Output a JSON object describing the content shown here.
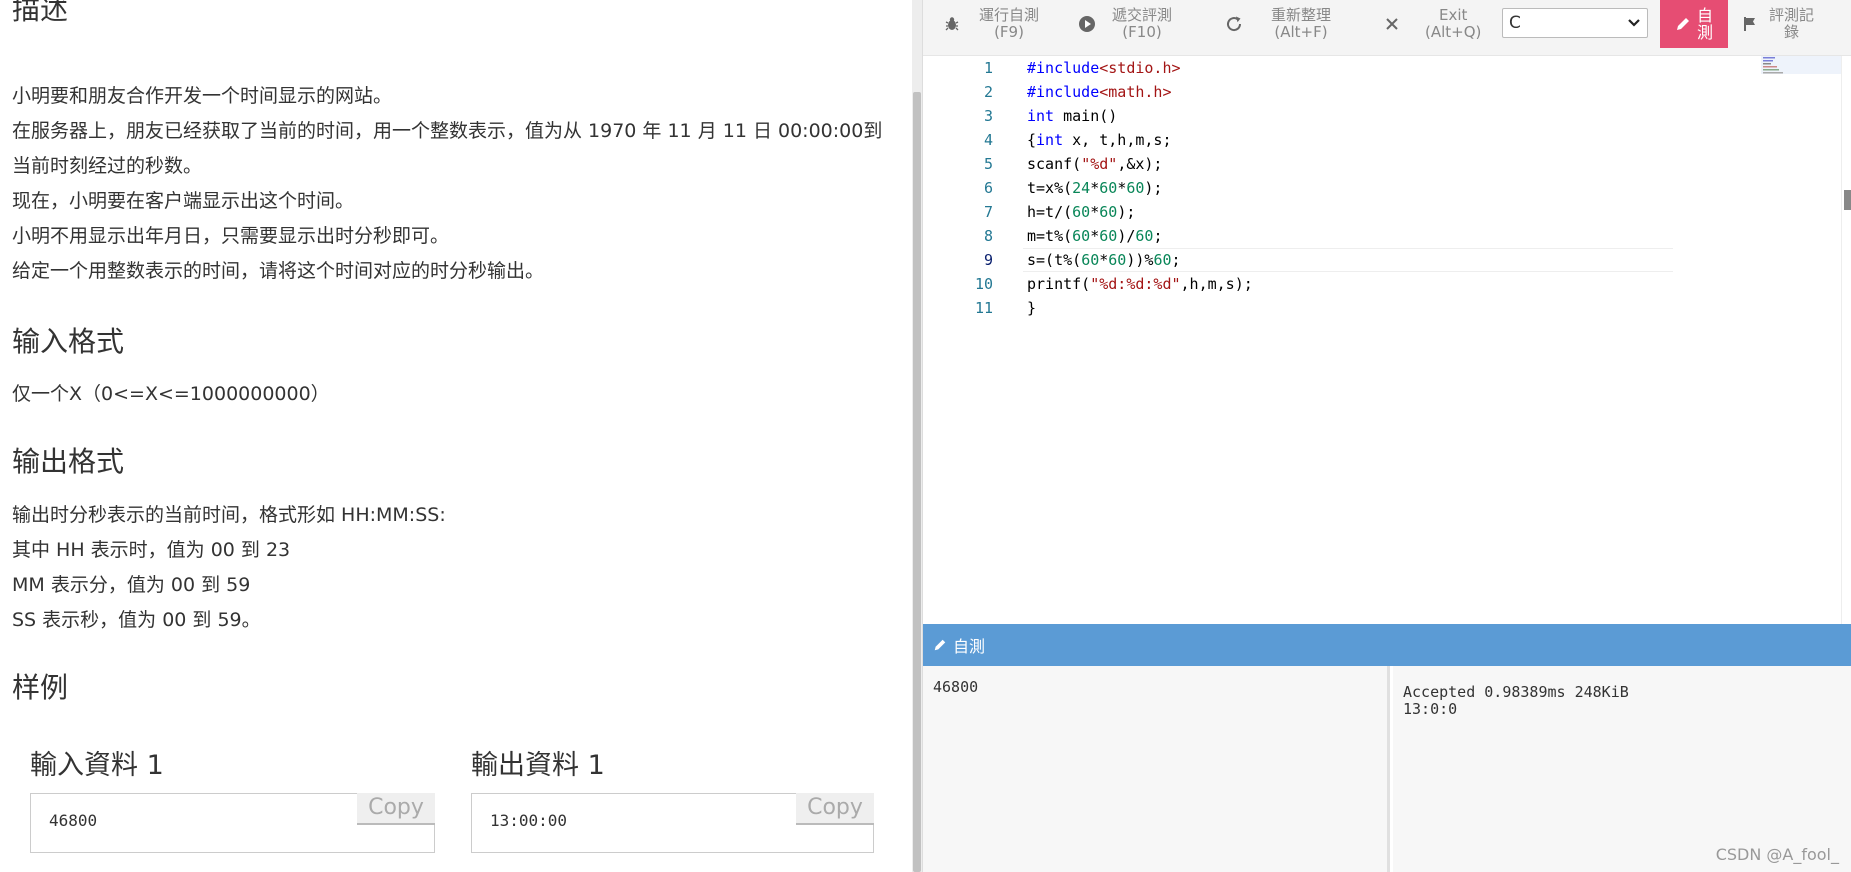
{
  "problem": {
    "description_heading": "描述",
    "description_lines": [
      "小明要和朋友合作开发一个时间显示的网站。",
      "在服务器上，朋友已经获取了当前的时间，用一个整数表示，值为从 1970 年 11 月 11 日 00:00:00到",
      "当前时刻经过的秒数。",
      "现在，小明要在客户端显示出这个时间。",
      "小明不用显示出年月日，只需要显示出时分秒即可。",
      "给定一个用整数表示的时间，请将这个时间对应的时分秒输出。"
    ],
    "input_heading": "输入格式",
    "input_text": "仅一个X（0<=X<=1000000000）",
    "output_heading": "输出格式",
    "output_lines": [
      "输出时分秒表示的当前时间，格式形如 HH:MM:SS:",
      "其中 HH 表示时，值为 00 到 23",
      "MM 表示分，值为 00 到 59",
      "SS 表示秒，值为 00 到 59。"
    ],
    "sample_heading": "样例",
    "sample_input_title": "輸入資料 1",
    "sample_input_value": "46800",
    "sample_output_title": "輸出資料 1",
    "sample_output_value": "13:00:00",
    "copy_label": "Copy"
  },
  "toolbar": {
    "run_label": "運行自測",
    "run_key": "(F9)",
    "submit_label": "遞交評測",
    "submit_key": "(F10)",
    "format_label": "重新整理",
    "format_key": "(Alt+F)",
    "exit_label": "Exit",
    "exit_key": "(Alt+Q)",
    "language": "C",
    "selftest_label_1": "自",
    "selftest_label_2": "測",
    "records_label_1": "評測記",
    "records_label_2": "錄"
  },
  "editor": {
    "line_numbers": [
      "1",
      "2",
      "3",
      "4",
      "5",
      "6",
      "7",
      "8",
      "9",
      "10",
      "11"
    ]
  },
  "panel": {
    "title": "自測",
    "stdin": "46800",
    "result_line_1": "Accepted 0.98389ms 248KiB",
    "result_line_2": "13:0:0",
    "watermark": "CSDN @A_fool_"
  }
}
